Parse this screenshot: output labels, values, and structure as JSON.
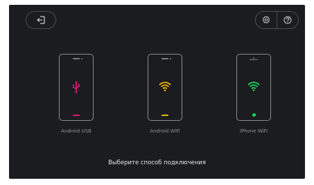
{
  "toolbar": {
    "back_icon": "exit-icon",
    "settings_icon": "gear-icon",
    "help_icon": "question-icon"
  },
  "options": [
    {
      "label": "Android USB",
      "icon": "usb-icon",
      "accent": "#e0197d"
    },
    {
      "label": "Android WiFi",
      "icon": "wifi-icon",
      "accent": "#f2b705"
    },
    {
      "label": "iPhone WiFi",
      "icon": "wifi-icon",
      "accent": "#1fd264"
    }
  ],
  "prompt": "Выберите способ подключения",
  "colors": {
    "background": "#1b1c1f",
    "outline": "#4b4d52"
  }
}
